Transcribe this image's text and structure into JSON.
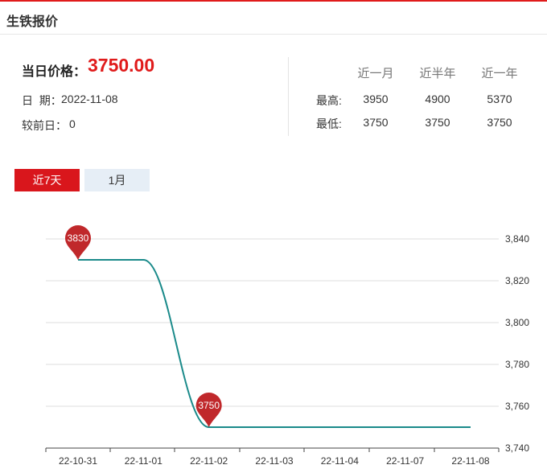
{
  "header": {
    "title": "生铁报价"
  },
  "summary": {
    "price_label": "当日价格：",
    "price_value": "3750.00",
    "date_label": "日  期：",
    "date_value": "2022-11-08",
    "prev_label": "较前日：",
    "prev_value": "0"
  },
  "stats": {
    "columns": [
      "近一月",
      "近半年",
      "近一年"
    ],
    "rows": [
      {
        "label": "最高:",
        "values": [
          "3950",
          "4900",
          "5370"
        ]
      },
      {
        "label": "最低:",
        "values": [
          "3750",
          "3750",
          "3750"
        ]
      }
    ]
  },
  "tabs": [
    {
      "label": "近7天",
      "active": true
    },
    {
      "label": "1月",
      "active": false
    }
  ],
  "colors": {
    "accent": "#e01b1b",
    "line": "#1a8a8a",
    "marker": "#c0282b",
    "tab_inactive": "#e6eef6"
  },
  "chart_data": {
    "type": "line",
    "categories": [
      "22-10-31",
      "22-11-01",
      "22-11-02",
      "22-11-03",
      "22-11-04",
      "22-11-07",
      "22-11-08"
    ],
    "series": [
      {
        "values": [
          3830,
          3830,
          3750,
          3750,
          3750,
          3750,
          3750
        ]
      }
    ],
    "ylim": [
      3740,
      3845
    ],
    "yticks": [
      3740,
      3760,
      3780,
      3800,
      3820,
      3840
    ],
    "ytick_labels": [
      "3,740",
      "3,760",
      "3,780",
      "3,800",
      "3,820",
      "3,840"
    ],
    "markers": [
      {
        "index": 0,
        "label": "3830"
      },
      {
        "index": 2,
        "label": "3750"
      }
    ],
    "smooth": true,
    "grid": true,
    "y_axis_position": "right"
  }
}
